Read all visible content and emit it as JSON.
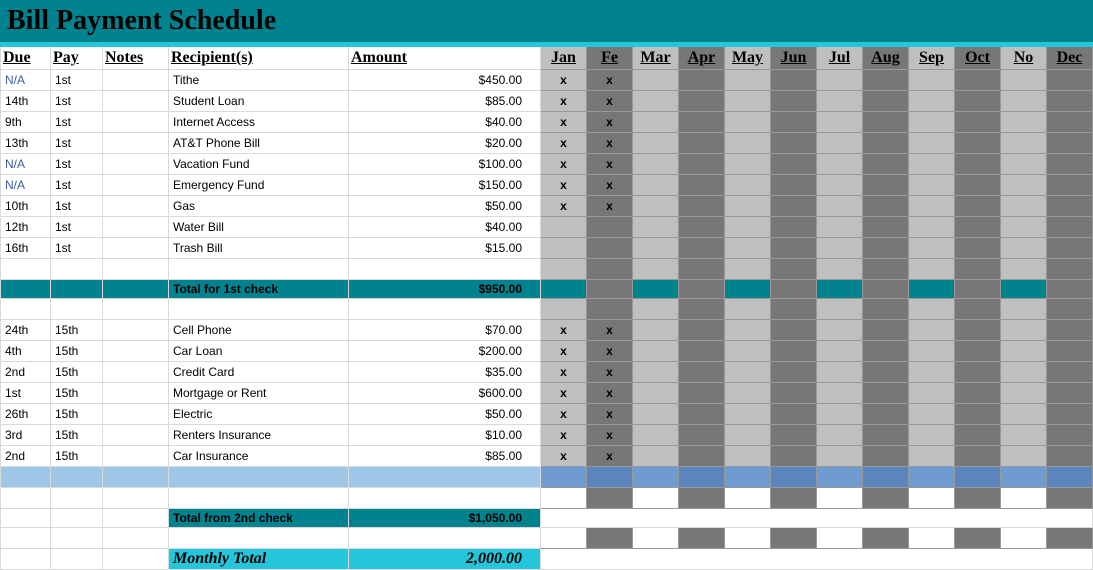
{
  "title": "Bill Payment Schedule",
  "headers": {
    "due": "Due",
    "pay": "Pay",
    "notes": "Notes",
    "recip": "Recipient(s)",
    "amt": "Amount"
  },
  "months": [
    "Jan",
    "Fe",
    "Mar",
    "Apr",
    "May",
    "Jun",
    "Jul",
    "Aug",
    "Sep",
    "Oct",
    "No",
    "Dec"
  ],
  "group1": [
    {
      "due": "N/A",
      "pay": "1st",
      "recip": "Tithe",
      "amt": "$450.00",
      "x": [
        "x",
        "x"
      ]
    },
    {
      "due": "14th",
      "pay": "1st",
      "recip": "Student Loan",
      "amt": "$85.00",
      "x": [
        "x",
        "x"
      ]
    },
    {
      "due": "9th",
      "pay": "1st",
      "recip": "Internet Access",
      "amt": "$40.00",
      "x": [
        "x",
        "x"
      ]
    },
    {
      "due": "13th",
      "pay": "1st",
      "recip": "AT&T Phone Bill",
      "amt": "$20.00",
      "x": [
        "x",
        "x"
      ]
    },
    {
      "due": "N/A",
      "pay": "1st",
      "recip": "Vacation Fund",
      "amt": "$100.00",
      "x": [
        "x",
        "x"
      ]
    },
    {
      "due": "N/A",
      "pay": "1st",
      "recip": "Emergency Fund",
      "amt": "$150.00",
      "x": [
        "x",
        "x"
      ]
    },
    {
      "due": "10th",
      "pay": "1st",
      "recip": "Gas",
      "amt": "$50.00",
      "x": [
        "x",
        "x"
      ]
    },
    {
      "due": "12th",
      "pay": "1st",
      "recip": "Water Bill",
      "amt": "$40.00",
      "x": [
        "",
        ""
      ]
    },
    {
      "due": "16th",
      "pay": "1st",
      "recip": "Trash Bill",
      "amt": "$15.00",
      "x": [
        "",
        ""
      ]
    }
  ],
  "subtotal1": {
    "label": "Total for 1st check",
    "amt": "$950.00"
  },
  "group2": [
    {
      "due": "24th",
      "pay": "15th",
      "recip": "Cell Phone",
      "amt": "$70.00",
      "x": [
        "x",
        "x"
      ]
    },
    {
      "due": "4th",
      "pay": "15th",
      "recip": "Car Loan",
      "amt": "$200.00",
      "x": [
        "x",
        "x"
      ]
    },
    {
      "due": "2nd",
      "pay": "15th",
      "recip": "Credit Card",
      "amt": "$35.00",
      "x": [
        "x",
        "x"
      ]
    },
    {
      "due": "1st",
      "pay": "15th",
      "recip": "Mortgage or Rent",
      "amt": "$600.00",
      "x": [
        "x",
        "x"
      ]
    },
    {
      "due": "26th",
      "pay": "15th",
      "recip": "Electric",
      "amt": "$50.00",
      "x": [
        "x",
        "x"
      ]
    },
    {
      "due": "3rd",
      "pay": "15th",
      "recip": "Renters Insurance",
      "amt": "$10.00",
      "x": [
        "x",
        "x"
      ]
    },
    {
      "due": "2nd",
      "pay": "15th",
      "recip": "Car Insurance",
      "amt": "$85.00",
      "x": [
        "x",
        "x"
      ]
    }
  ],
  "subtotal2": {
    "label": "Total from 2nd check",
    "amt": "$1,050.00"
  },
  "monthly": {
    "label": "Monthly Total",
    "amt": "2,000.00"
  }
}
